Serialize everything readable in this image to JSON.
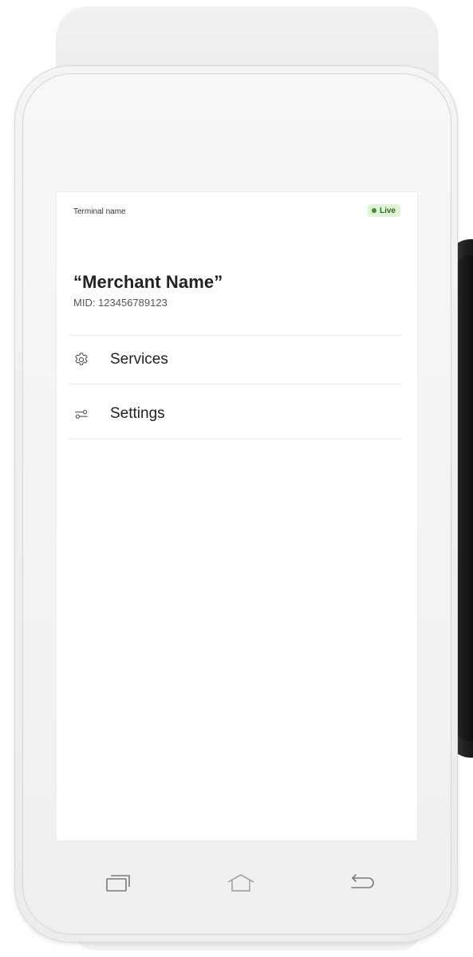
{
  "header": {
    "terminal_label": "Terminal name",
    "status_badge": "Live",
    "status_color": "#3f8f2d",
    "status_bg": "#dff2d4"
  },
  "merchant": {
    "name": "“Merchant Name”",
    "mid": "MID: 123456789123"
  },
  "menu": {
    "items": [
      {
        "label": "Services",
        "icon": "gear-icon"
      },
      {
        "label": "Settings",
        "icon": "sliders-icon"
      }
    ]
  },
  "navbar": {
    "buttons": [
      {
        "icon": "recent-apps-icon"
      },
      {
        "icon": "home-icon"
      },
      {
        "icon": "back-icon"
      }
    ]
  }
}
